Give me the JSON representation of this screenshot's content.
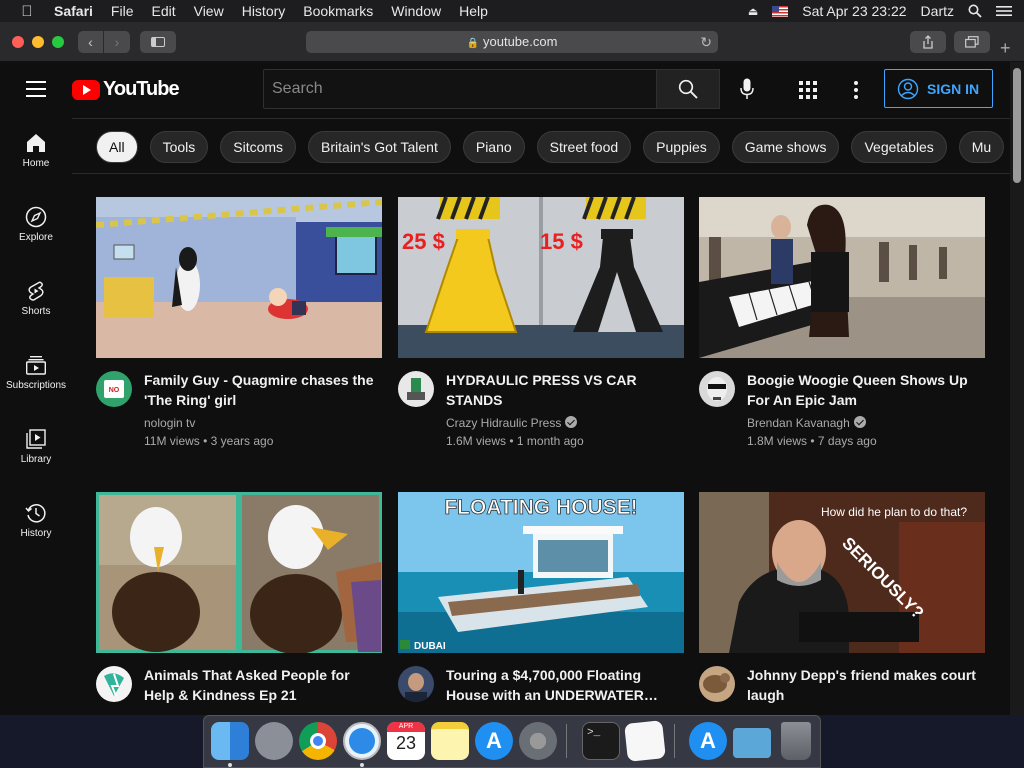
{
  "menubar": {
    "app": "Safari",
    "items": [
      "File",
      "Edit",
      "View",
      "History",
      "Bookmarks",
      "Window",
      "Help"
    ],
    "datetime": "Sat Apr 23  23:22",
    "user": "Dartz"
  },
  "browser": {
    "url": "youtube.com"
  },
  "youtube": {
    "logo_text": "YouTube",
    "search_placeholder": "Search",
    "signin_label": "SIGN IN",
    "nav": [
      {
        "label": "Home",
        "icon": "home-icon"
      },
      {
        "label": "Explore",
        "icon": "compass-icon"
      },
      {
        "label": "Shorts",
        "icon": "shorts-icon"
      },
      {
        "label": "Subscriptions",
        "icon": "subscriptions-icon"
      },
      {
        "label": "Library",
        "icon": "library-icon"
      },
      {
        "label": "History",
        "icon": "history-icon"
      }
    ],
    "chips": [
      "All",
      "Tools",
      "Sitcoms",
      "Britain's Got Talent",
      "Piano",
      "Street food",
      "Puppies",
      "Game shows",
      "Vegetables",
      "Mu"
    ],
    "videos": [
      {
        "title": "Family Guy - Quagmire chases the 'The Ring' girl",
        "channel": "nologin tv",
        "verified": false,
        "views": "11M views",
        "age": "3 years ago"
      },
      {
        "title": "HYDRAULIC PRESS VS CAR STANDS",
        "channel": "Crazy Hidraulic Press",
        "verified": true,
        "views": "1.6M views",
        "age": "1 month ago",
        "thumb_text": [
          "25 $",
          "15 $"
        ]
      },
      {
        "title": "Boogie Woogie Queen Shows Up For An Epic Jam",
        "channel": "Brendan Kavanagh",
        "verified": true,
        "views": "1.8M views",
        "age": "7 days ago"
      },
      {
        "title": "Animals That Asked People for Help & Kindness Ep 21",
        "channel": "",
        "verified": false,
        "views": "",
        "age": ""
      },
      {
        "title": "Touring a $4,700,000 Floating House with an UNDERWATER…",
        "channel": "",
        "verified": false,
        "views": "",
        "age": "",
        "thumb_text": [
          "FLOATING HOUSE!",
          "DUBAI"
        ]
      },
      {
        "title": "Johnny Depp's friend makes court laugh",
        "channel": "",
        "verified": false,
        "views": "",
        "age": "",
        "thumb_text": [
          "How did he plan to do that?",
          "SERIOUSLY?"
        ]
      }
    ]
  },
  "dock": {
    "apps": [
      "finder-icon",
      "launchpad-icon",
      "chrome-icon",
      "safari-icon",
      "calendar-icon",
      "notes-icon",
      "app-store-icon",
      "system-preferences-icon",
      "terminal-icon",
      "textedit-icon",
      "app-store-folder-icon",
      "folder-icon",
      "trash-icon"
    ],
    "calendar_day": "23",
    "calendar_month": "APR"
  }
}
